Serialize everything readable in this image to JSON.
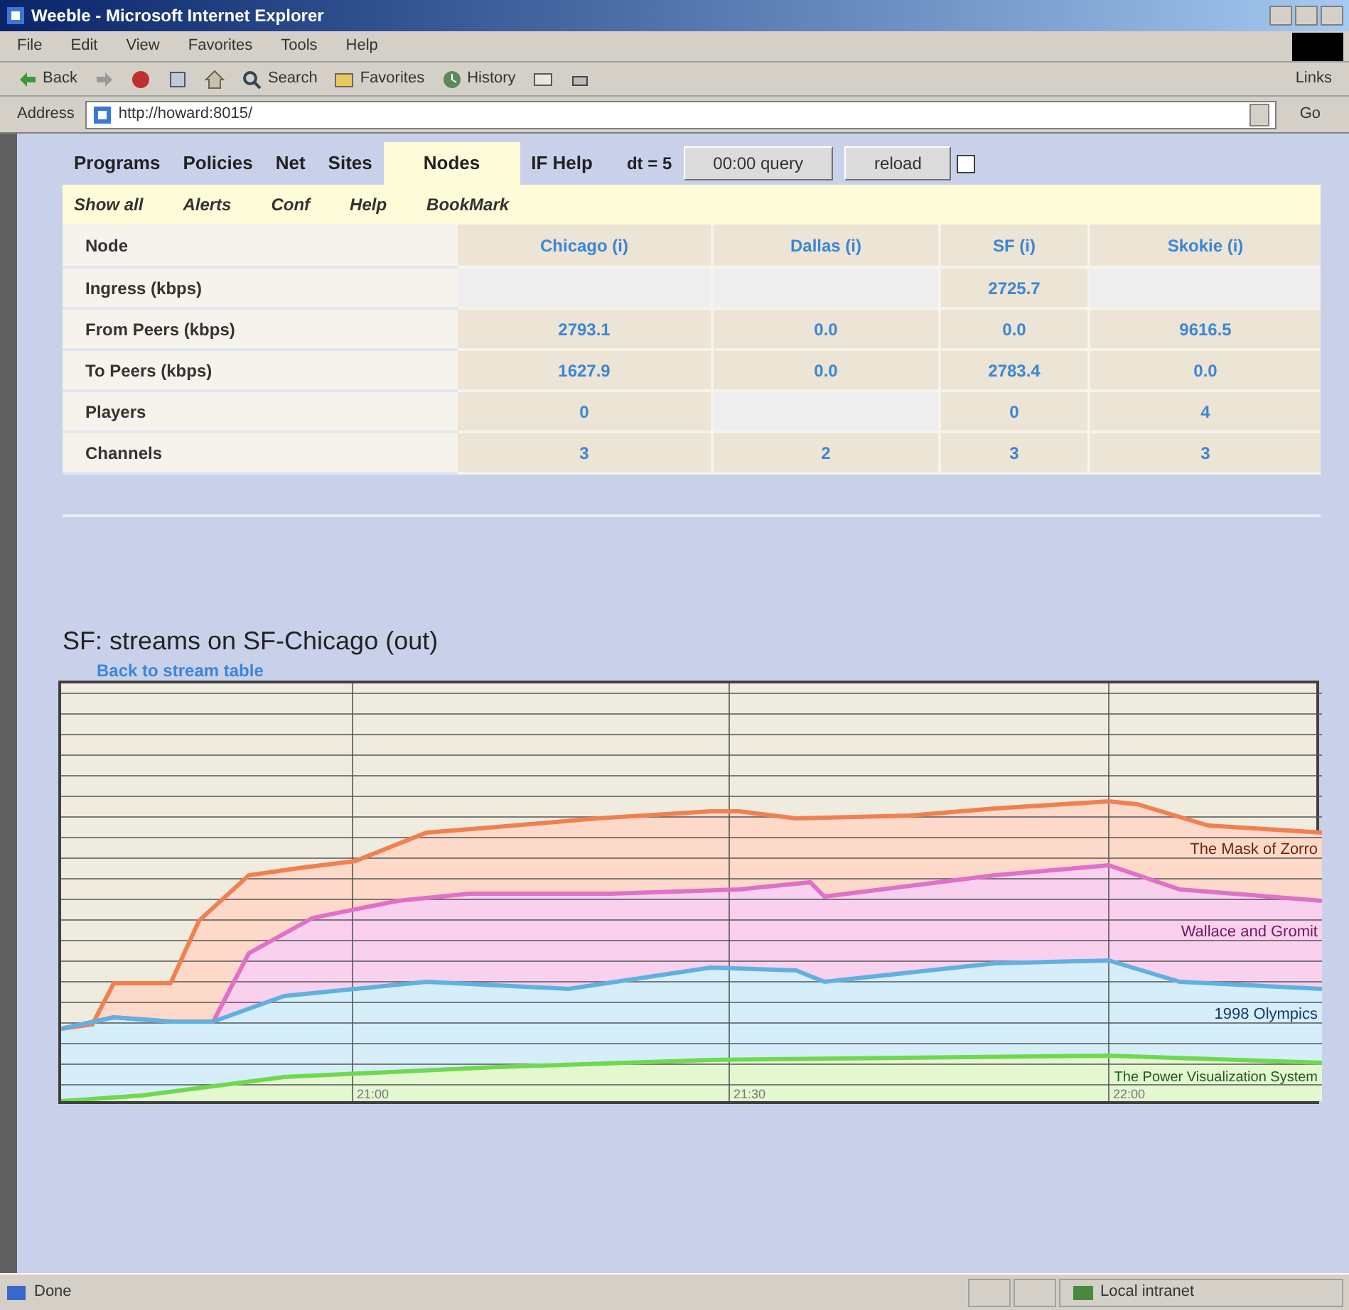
{
  "window": {
    "title": "Weeble - Microsoft Internet Explorer"
  },
  "menu": [
    "File",
    "Edit",
    "View",
    "Favorites",
    "Tools",
    "Help"
  ],
  "toolbar": [
    {
      "kind": "back",
      "label": "Back"
    },
    {
      "kind": "forward"
    },
    {
      "kind": "stop"
    },
    {
      "kind": "refresh"
    },
    {
      "kind": "home"
    },
    {
      "kind": "search",
      "label": "Search"
    },
    {
      "kind": "favorites",
      "label": "Favorites"
    },
    {
      "kind": "history",
      "label": "History"
    },
    {
      "kind": "mail"
    },
    {
      "kind": "print"
    }
  ],
  "links_label": "Links",
  "address": {
    "label": "Address",
    "value": "http://howard:8015/",
    "go": "Go"
  },
  "nav_tabs": [
    {
      "label": "Programs",
      "selected": false
    },
    {
      "label": "Policies",
      "selected": false
    },
    {
      "label": "Net",
      "selected": false
    },
    {
      "label": "Sites",
      "selected": false
    },
    {
      "label": "Nodes",
      "selected": true
    },
    {
      "label": "IF Help",
      "selected": false
    }
  ],
  "dt": "dt = 5",
  "buttons": [
    "00:00 query",
    "reload"
  ],
  "auto_checkbox": {
    "checked": false
  },
  "subnav": [
    "Show all",
    "Alerts",
    "Conf",
    "Help",
    "BookMark"
  ],
  "table": {
    "columns": [
      "Node",
      "Chicago (i)",
      "Dallas (i)",
      "SF (i)",
      "Skokie (i)"
    ],
    "rows": [
      [
        "Ingress (kbps)",
        null,
        null,
        "2725.7",
        null
      ],
      [
        "From Peers (kbps)",
        "2793.1",
        "0.0",
        "0.0",
        "9616.5"
      ],
      [
        "To Peers (kbps)",
        "1627.9",
        "0.0",
        "2783.4",
        "0.0"
      ],
      [
        "Players",
        "0",
        null,
        "0",
        "4"
      ],
      [
        "Channels",
        "3",
        "2",
        "3",
        "3"
      ]
    ]
  },
  "chart_title": "SF: streams on SF-Chicago (out)",
  "back_link": "Back to stream table",
  "chart": {
    "x_labels": [
      "21:00",
      "21:30",
      "22:00"
    ],
    "series": [
      {
        "name": "The Mask of Zorro",
        "color": "#f08050"
      },
      {
        "name": "Wallace and Gromit",
        "color": "#e070c8"
      },
      {
        "name": "1998 Olympics",
        "color": "#60b0e0"
      },
      {
        "name": "The Power Visualization System",
        "color": "#70d850"
      }
    ]
  },
  "status_bar": {
    "text": "Done",
    "zone": "Local intranet"
  }
}
